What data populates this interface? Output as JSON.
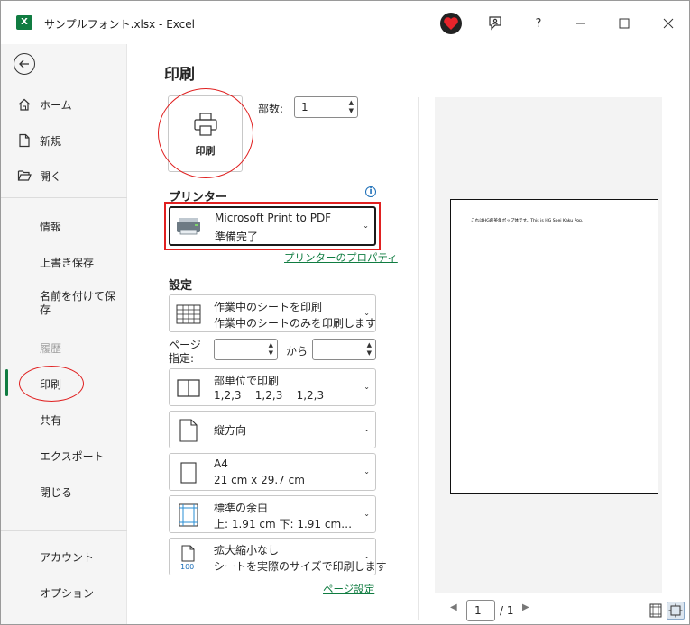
{
  "window": {
    "title": "サンプルフォント.xlsx  -  Excel",
    "app_icon_letter": "X"
  },
  "titlebar": {
    "help_label": "?"
  },
  "sidebar": {
    "items": [
      {
        "label": "ホーム",
        "icon": "home-icon"
      },
      {
        "label": "新規",
        "icon": "new-document-icon"
      },
      {
        "label": "開く",
        "icon": "open-folder-icon"
      },
      {
        "label": "情報"
      },
      {
        "label": "上書き保存"
      },
      {
        "label": "名前を付けて保存"
      },
      {
        "label": "履歴"
      },
      {
        "label": "印刷"
      },
      {
        "label": "共有"
      },
      {
        "label": "エクスポート"
      },
      {
        "label": "閉じる"
      },
      {
        "label": "アカウント"
      },
      {
        "label": "オプション"
      }
    ],
    "name_save_line1": "名前を付けて保",
    "name_save_line2": "存"
  },
  "main": {
    "title": "印刷",
    "print_button_label": "印刷",
    "copies_label": "部数:",
    "copies_value": "1",
    "printer_section": "プリンター",
    "printer_name": "Microsoft Print to PDF",
    "printer_status": "準備完了",
    "printer_properties_link": "プリンターのプロパティ",
    "settings_section": "設定",
    "options": [
      {
        "line1": "作業中のシートを印刷",
        "line2": "作業中のシートのみを印刷します"
      },
      {
        "line1": "部単位で印刷",
        "line2": "1,2,3    1,2,3    1,2,3"
      },
      {
        "line1": "縦方向"
      },
      {
        "line1": "A4",
        "line2": "21 cm x 29.7 cm"
      },
      {
        "line1": "標準の余白",
        "line2": "上: 1.91 cm 下: 1.91 cm…"
      },
      {
        "line1": "拡大縮小なし",
        "line2": "シートを実際のサイズで印刷します",
        "icon_text": "100"
      }
    ],
    "pages_label_line1": "ページ",
    "pages_label_line2": "指定:",
    "pages_to_label": "から",
    "page_setup_link": "ページ設定"
  },
  "preview": {
    "sample_text": "これはHG創英角ポップ体です。This is HG Soei Kaku Pop.",
    "current_page": "1",
    "total_pages": "/ 1"
  },
  "colors": {
    "accent": "#107c41",
    "annotation": "#e02020"
  }
}
